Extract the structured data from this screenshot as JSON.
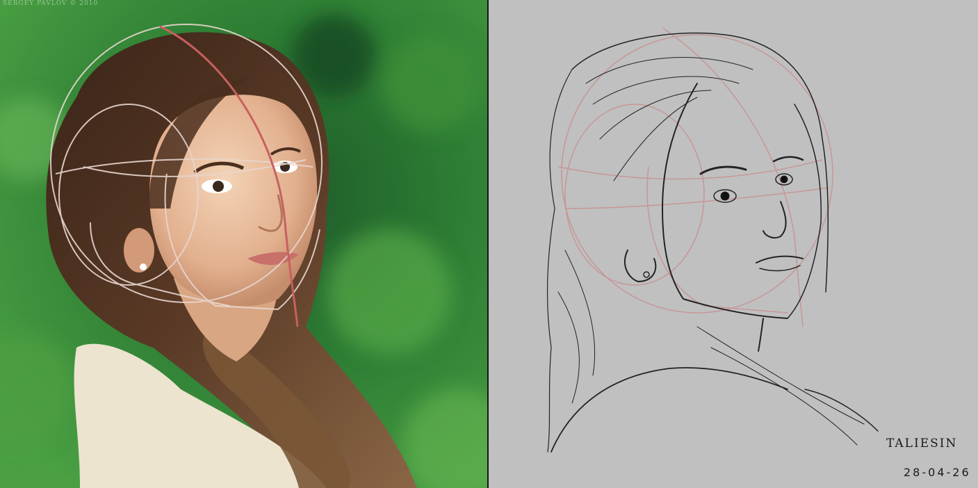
{
  "photo": {
    "watermark": "SERGEY PAVLOV © 2010"
  },
  "sketch": {
    "signature": "TALIESIN",
    "date": "28-04-26"
  },
  "colors": {
    "photo_background": "#2f7a35",
    "sketch_background": "#c0c0c0",
    "construction_line": "#c86060",
    "pencil_line": "#222222"
  }
}
